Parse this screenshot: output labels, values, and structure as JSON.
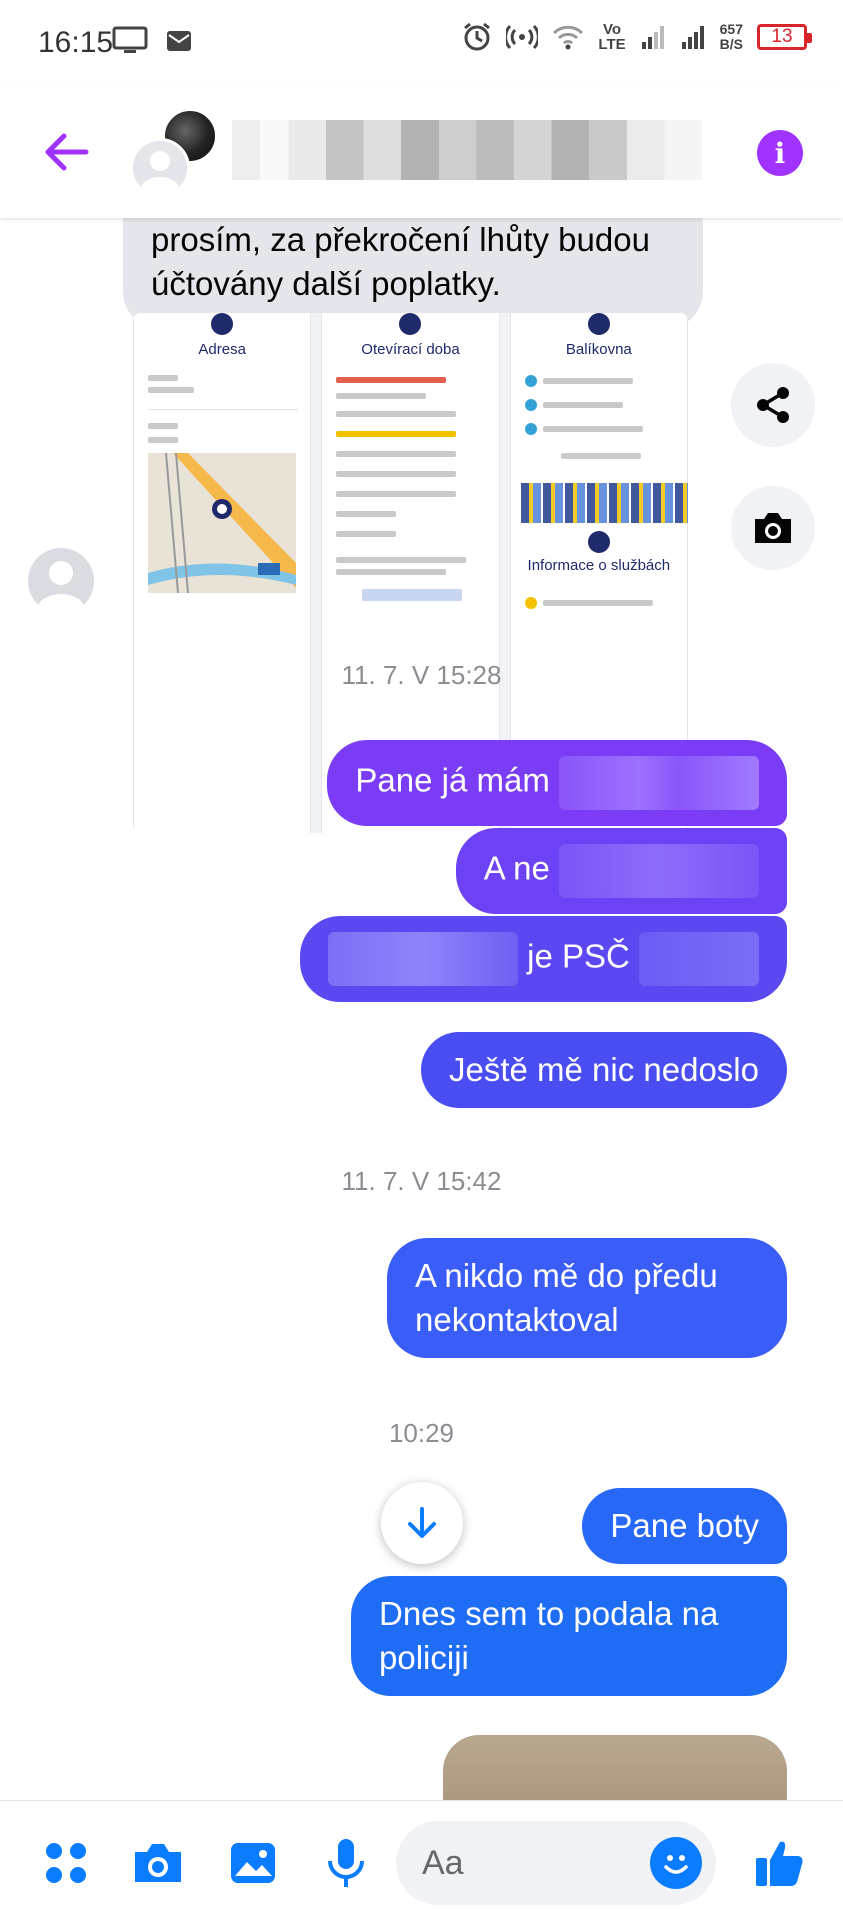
{
  "status_bar": {
    "time": "16:15",
    "volte": "Vo\nLTE",
    "net_speed_value": "657",
    "net_speed_unit": "B/S",
    "battery": "13"
  },
  "header": {
    "contact_name": "",
    "info_icon": "i"
  },
  "conversation": {
    "incoming_text": "prosím, za překročení lhůty budou účtovány další poplatky.",
    "media_panels": {
      "address_title": "Adresa",
      "hours_title": "Otevírací doba",
      "balikovna_title": "Balíkovna",
      "services_title": "Informace o službách"
    },
    "timestamp_1": "11. 7. V 15:28",
    "msg_1_visible": "Pane já mám",
    "msg_2_visible": "A ne",
    "msg_3_visible": "je PSČ",
    "msg_4": "Ještě mě nic nedoslo",
    "timestamp_2": "11. 7. V 15:42",
    "msg_5_line1": "A nikdo mě do předu",
    "msg_5_line2": "nekontaktoval",
    "timestamp_3": "10:29",
    "msg_6": "Pane boty",
    "msg_7_line1": "Dnes sem to podala na",
    "msg_7_line2": "policiji"
  },
  "composer": {
    "placeholder": "Aa"
  },
  "colors": {
    "accent_purple": "#a033ff",
    "bubble_violet": "#7a3cf5",
    "bubble_indigo": "#5b48f0",
    "bubble_blue": "#3a5cf7",
    "bubble_bright_blue": "#1f6df5",
    "messenger_blue": "#0a7cff",
    "incoming_gray": "#e4e6eb"
  },
  "icons": {
    "back": "arrow-left-icon",
    "info": "info-icon",
    "share": "share-icon",
    "camera": "camera-icon",
    "apps": "apps-icon",
    "gallery": "gallery-icon",
    "mic": "microphone-icon",
    "emoji": "emoji-icon",
    "like": "thumbs-up-icon",
    "scroll_down": "arrow-down-icon"
  }
}
